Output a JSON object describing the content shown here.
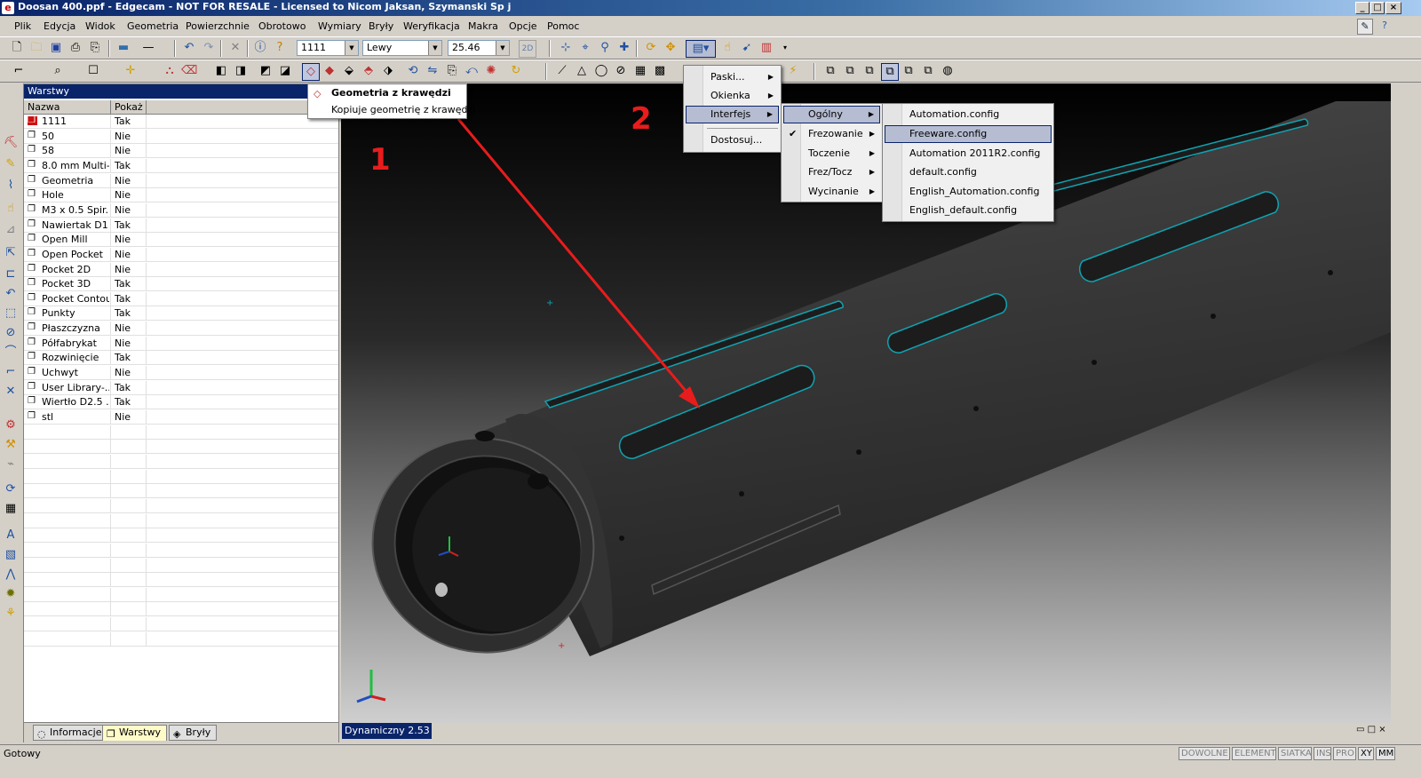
{
  "window": {
    "title": "Doosan 400.ppf - Edgecam - NOT FOR RESALE - Licensed to Nicom Jaksan, Szymanski Sp j",
    "app_icon": "edgecam-logo-icon"
  },
  "menubar": [
    "Plik",
    "Edycja",
    "Widok",
    "Geometria",
    "Powierzchnie",
    "Obrotowo",
    "Wymiary",
    "Bryły",
    "Weryfikacja",
    "Makra",
    "Opcje",
    "Pomoc"
  ],
  "toolbar": {
    "layer_combo": "1111",
    "view_combo": "Lewy",
    "value_combo": "25.46",
    "btn_2d": "2D"
  },
  "tooltip": {
    "title": "Geometria z krawędzi",
    "description": "Kopiuje geometrię z krawędzi"
  },
  "layer_panel": {
    "title": "Warstwy",
    "col_name": "Nazwa",
    "col_show": "Pokaż",
    "rows": [
      {
        "name": "1111",
        "show": "Tak",
        "current": true
      },
      {
        "name": "50",
        "show": "Nie"
      },
      {
        "name": "58",
        "show": "Nie"
      },
      {
        "name": "8.0 mm Multi-...",
        "show": "Tak"
      },
      {
        "name": "Geometria",
        "show": "Nie"
      },
      {
        "name": "Hole",
        "show": "Nie"
      },
      {
        "name": "M3 x 0.5 Spir...",
        "show": "Nie"
      },
      {
        "name": "Nawiertak D1...",
        "show": "Tak"
      },
      {
        "name": "Open Mill",
        "show": "Nie"
      },
      {
        "name": "Open Pocket",
        "show": "Nie"
      },
      {
        "name": "Pocket 2D",
        "show": "Nie"
      },
      {
        "name": "Pocket 3D",
        "show": "Tak"
      },
      {
        "name": "Pocket Contour",
        "show": "Tak"
      },
      {
        "name": "Punkty",
        "show": "Tak"
      },
      {
        "name": "Płaszczyzna",
        "show": "Nie"
      },
      {
        "name": "Półfabrykat",
        "show": "Nie"
      },
      {
        "name": "Rozwinięcie",
        "show": "Tak"
      },
      {
        "name": "Uchwyt",
        "show": "Nie"
      },
      {
        "name": "User Library-...",
        "show": "Tak"
      },
      {
        "name": "Wiertło D2.5 ...",
        "show": "Tak"
      },
      {
        "name": "stl",
        "show": "Nie"
      }
    ],
    "tabs": [
      "Informacje",
      "Warstwy",
      "Bryły"
    ],
    "active_tab": "Warstwy"
  },
  "context_menu": {
    "items": [
      "Paski...",
      "Okienka",
      "Interfejs",
      "Dostosuj..."
    ],
    "highlighted": "Interfejs"
  },
  "submenu_interfejs": {
    "items": [
      "Ogólny",
      "Frezowanie",
      "Toczenie",
      "Frez/Tocz",
      "Wycinanie"
    ],
    "highlighted": "Ogólny",
    "checked": "Frezowanie"
  },
  "submenu_ogolny": {
    "items": [
      "Automation.config",
      "Freeware.config",
      "Automation 2011R2.config",
      "default.config",
      "English_Automation.config",
      "English_default.config"
    ],
    "highlighted": "Freeware.config"
  },
  "annotations": {
    "label_1": "1",
    "label_2": "2",
    "color": "#e81c1c"
  },
  "viewport": {
    "status": "Dynamiczny 2.53"
  },
  "statusbar": {
    "text": "Gotowy",
    "indicators": [
      "DOWOLNE",
      "ELEMENT",
      "SIATKA",
      "INS",
      "PRO",
      "XY",
      "MM"
    ]
  }
}
